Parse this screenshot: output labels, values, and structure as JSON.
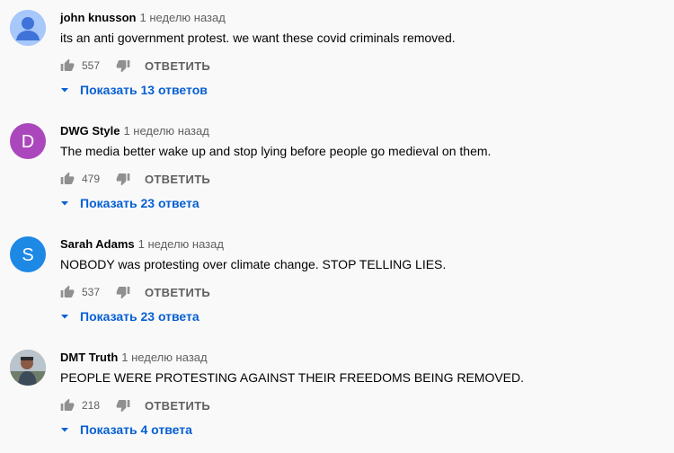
{
  "comments": [
    {
      "author": "john knusson",
      "time": "1 неделю назад",
      "text": "its an anti government protest. we want these covid criminals removed.",
      "likes": "557",
      "reply_label": "ОТВЕТИТЬ",
      "replies_label": "Показать 13 ответов",
      "avatar": {
        "type": "default-person-icon",
        "bg": "#a8c7fa",
        "fg": "#3f73d8"
      }
    },
    {
      "author": "DWG Style",
      "time": "1 неделю назад",
      "text": "The media better wake up and stop lying before people go medieval on them.",
      "likes": "479",
      "reply_label": "ОТВЕТИТЬ",
      "replies_label": "Показать 23 ответа",
      "avatar": {
        "type": "letter",
        "letter": "D",
        "bg": "#ab47bc"
      }
    },
    {
      "author": "Sarah Adams",
      "time": "1 неделю назад",
      "text": "NOBODY was protesting over climate change. STOP TELLING LIES.",
      "likes": "537",
      "reply_label": "ОТВЕТИТЬ",
      "replies_label": "Показать 23 ответа",
      "avatar": {
        "type": "letter",
        "letter": "S",
        "bg": "#1e88e5"
      }
    },
    {
      "author": "DMT Truth",
      "time": "1 неделю назад",
      "text": "PEOPLE WERE PROTESTING AGAINST THEIR FREEDOMS BEING REMOVED.",
      "likes": "218",
      "reply_label": "ОТВЕТИТЬ",
      "replies_label": "Показать 4 ответа",
      "avatar": {
        "type": "photo-avatar-icon",
        "bg": "#8d9aa5"
      }
    }
  ],
  "colors": {
    "background": "#f9f9f9",
    "text": "#030303",
    "secondary_text": "#606060",
    "link_blue": "#065fd4",
    "icon_gray": "#909090"
  }
}
